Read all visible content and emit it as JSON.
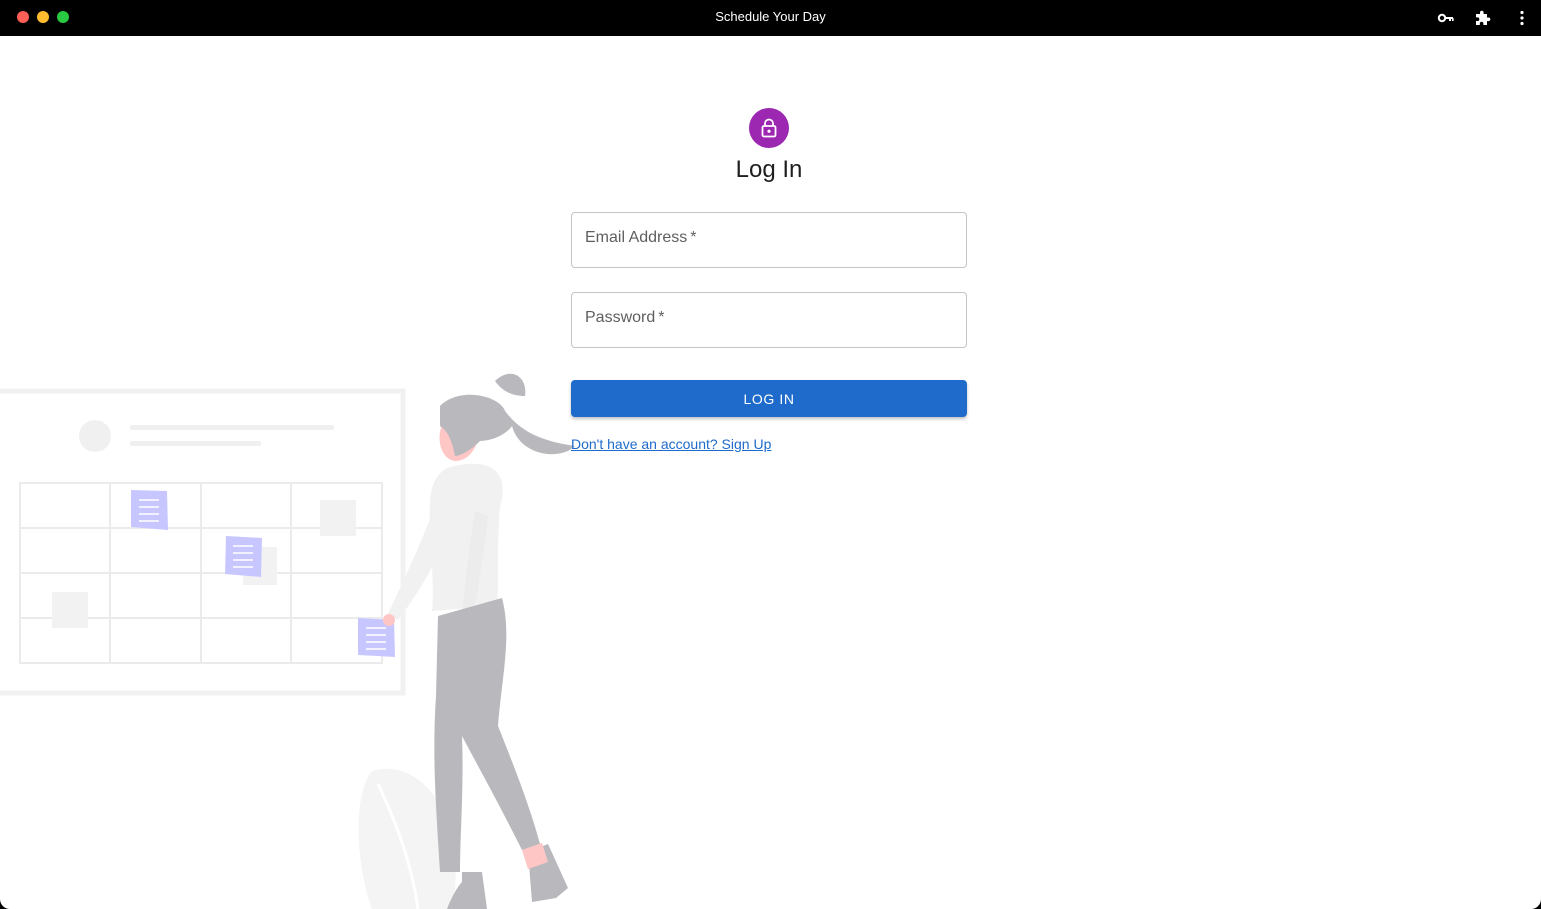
{
  "window": {
    "title": "Schedule Your Day",
    "traffic_lights": [
      "#fe5f57",
      "#febc2e",
      "#28c840"
    ],
    "toolbar_icons": [
      "key-icon",
      "puzzle-icon",
      "more-vert-icon"
    ]
  },
  "login": {
    "avatar_icon": "lock-icon",
    "avatar_color": "#9c27b0",
    "heading": "Log In",
    "email_label": "Email Address",
    "password_label": "Password",
    "required_mark": "*",
    "submit_label": "LOG IN",
    "submit_color": "#1e6bcb",
    "signup_link": "Don't have an account? Sign Up"
  },
  "illustration": {
    "subject": "person-with-calendar-illustration",
    "note_color": "#c8c6ff"
  }
}
